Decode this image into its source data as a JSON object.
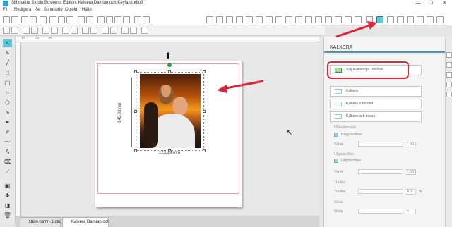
{
  "window": {
    "title": "Silhouette Studio Business Edition: Kalkera Damian och Keyla.studio3",
    "controls": {
      "minimize": "—",
      "maximize": "☐",
      "close": "✕"
    }
  },
  "menu": {
    "items": [
      "Fil",
      "Redigera",
      "Se",
      "Silhouette",
      "Objekt",
      "Hjälp"
    ]
  },
  "tool_icons": [
    "new-icon",
    "open-icon",
    "save-icon",
    "print-icon",
    "send-icon",
    "cut-icon",
    "copy-icon",
    "paste-icon",
    "undo-icon",
    "redo-icon",
    "zoom-in-icon",
    "zoom-out-icon",
    "fit-icon",
    "move-icon",
    "draw-icon",
    "grid-icon"
  ],
  "ruler": {
    "top_marks": [
      "10",
      "20",
      "30"
    ]
  },
  "document": {
    "width_label": "123,19 mm",
    "height_label": "145,93 mm"
  },
  "tabs": [
    {
      "label": "Utan namn-1.studio3"
    },
    {
      "label": "Kalkera Damian och ..."
    }
  ],
  "panel": {
    "title": "KALKERA",
    "select_button": "Välj Kalkerings Område",
    "buttons": [
      "Kalkera",
      "Kalkera Ytterkant",
      "Kalkera och Lossa"
    ],
    "sections": {
      "filters": "Filteralternativ",
      "high_pass": "Högpassfilter",
      "low_pass": "Lågpassfilter",
      "threshold_sec": "Tröskel",
      "scale_sec": "Skala"
    },
    "labels": {
      "value1": "Värde",
      "value2": "Värde",
      "threshold": "Tröskel",
      "scale": "Skala"
    },
    "values": {
      "high_pass": "1,00",
      "low_pass": "1,00",
      "threshold": "0,0",
      "threshold_unit": "%",
      "scale": "4"
    }
  },
  "colors": {
    "accent": "#3c9fc0",
    "annotation_red": "#d9263a",
    "selected_tool": "#5cc8d8"
  }
}
